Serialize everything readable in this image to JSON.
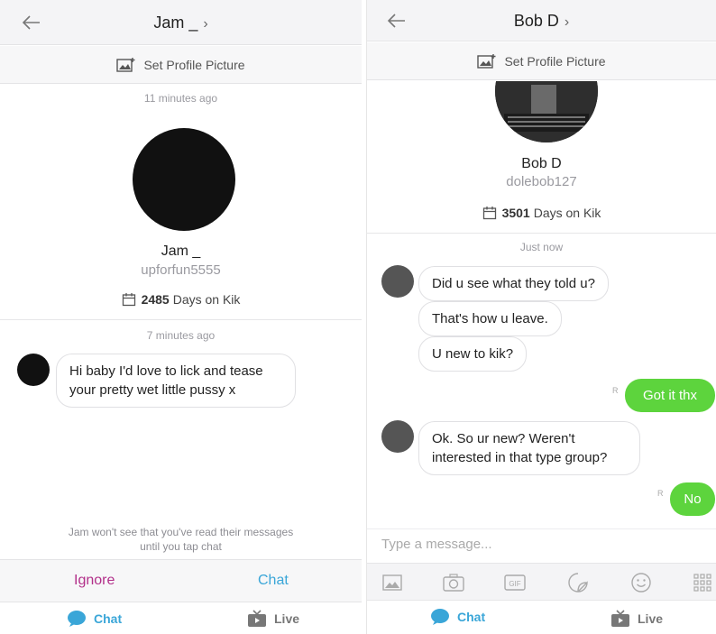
{
  "left": {
    "header": {
      "title": "Jam _"
    },
    "set_profile_picture": "Set Profile Picture",
    "timestamp_top": "11 minutes ago",
    "profile": {
      "display_name": "Jam _",
      "username": "upforfun5555",
      "days_count": "2485",
      "days_label": "Days on Kik"
    },
    "timestamp_msg": "7 minutes ago",
    "messages": [
      {
        "line1": "Hi baby I'd love to lick and tease",
        "line2": "your pretty wet little pussy x"
      }
    ],
    "read_note_line1": "Jam won't see that you've read their messages",
    "read_note_line2": "until you tap chat",
    "actions": {
      "ignore": "Ignore",
      "chat": "Chat"
    },
    "tabs": {
      "chat": "Chat",
      "live": "Live"
    }
  },
  "right": {
    "header": {
      "title": "Bob D"
    },
    "set_profile_picture": "Set Profile Picture",
    "profile": {
      "display_name": "Bob D",
      "username": "dolebob127",
      "days_count": "3501",
      "days_label": "Days on Kik"
    },
    "timestamp_msg": "Just now",
    "messages_in_1": [
      "Did u see what they told u?",
      "That's how u leave.",
      "U new to kik?"
    ],
    "message_out_1": "Got it thx",
    "message_in_2": {
      "line1": "Ok. So ur new? Weren't",
      "line2": "interested in that type group?"
    },
    "message_out_2": "No",
    "receipt": "R",
    "composer_placeholder": "Type a message...",
    "media": {
      "gif": "GIF"
    },
    "tabs": {
      "chat": "Chat",
      "live": "Live"
    }
  },
  "colors": {
    "kik_green": "#5dd43d",
    "accent_blue": "#3aa6d8",
    "ignore_magenta": "#b2308a"
  }
}
